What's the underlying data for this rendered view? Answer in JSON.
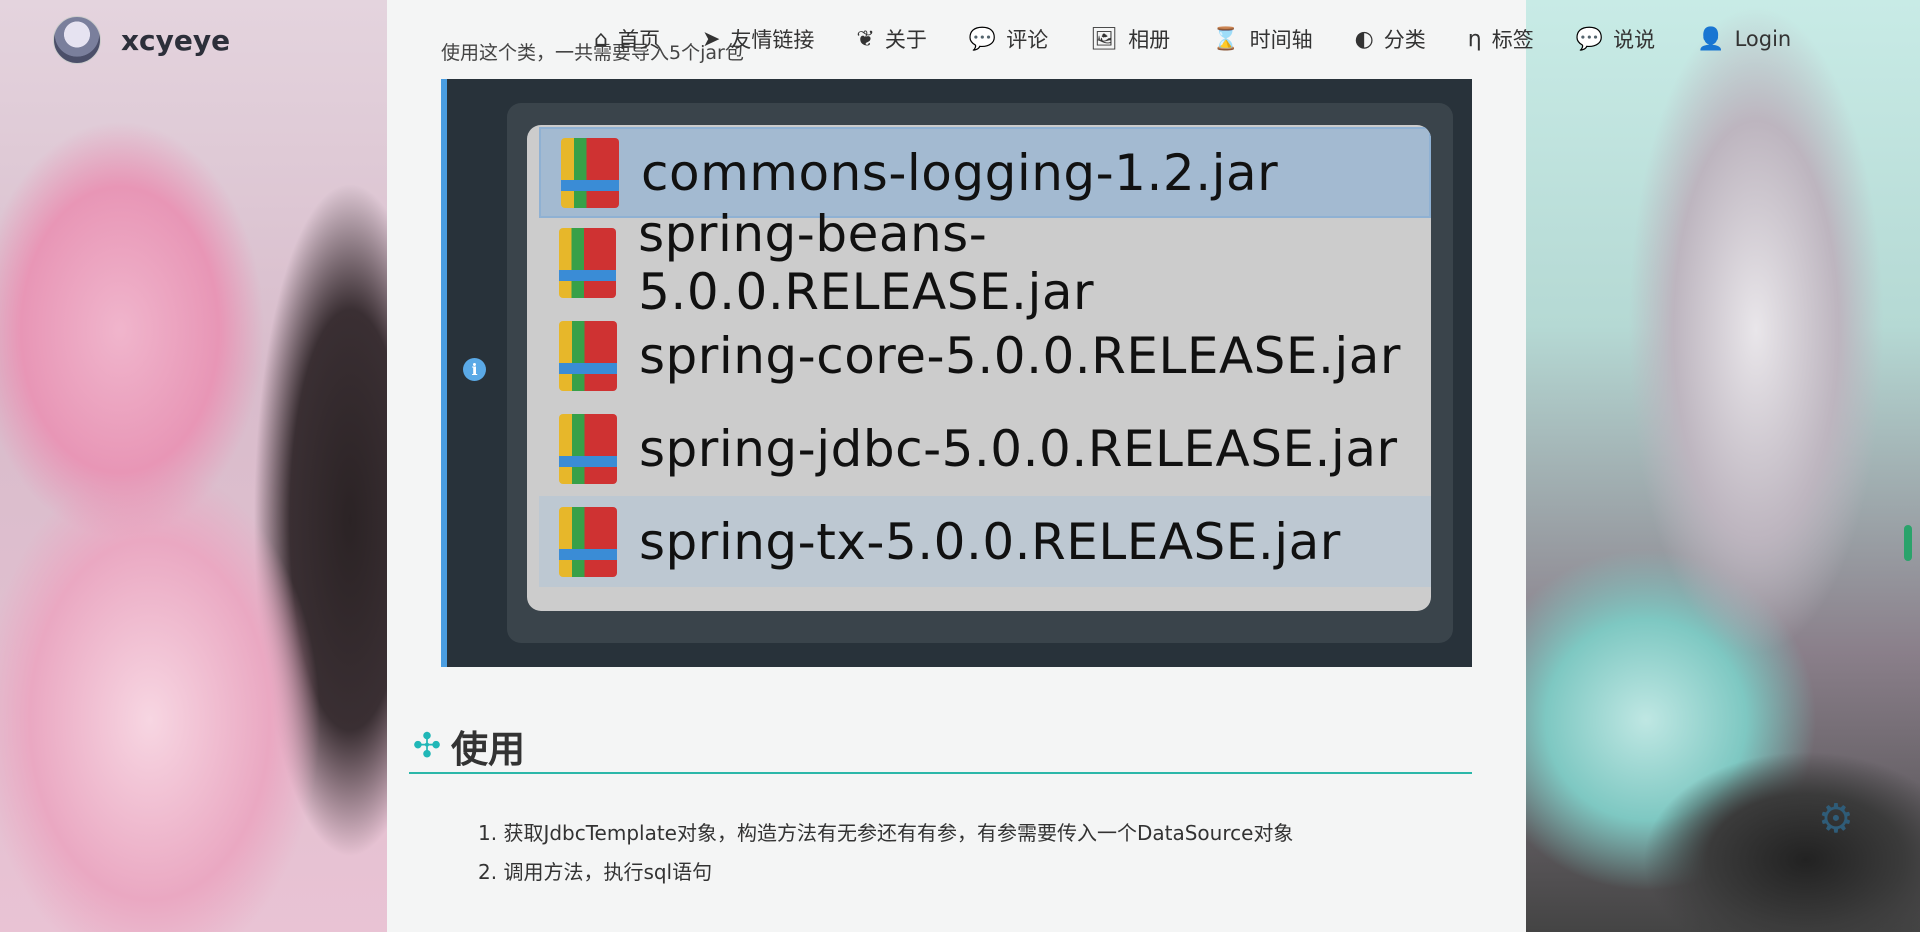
{
  "site": {
    "name": "xcyeye"
  },
  "nav": {
    "items": [
      {
        "id": "home",
        "label": "首页",
        "icon": "⌂"
      },
      {
        "id": "links",
        "label": "友情链接",
        "icon": "➤"
      },
      {
        "id": "about",
        "label": "关于",
        "icon": "❦"
      },
      {
        "id": "comments",
        "label": "评论",
        "icon": "💬"
      },
      {
        "id": "album",
        "label": "相册",
        "icon": "🖼"
      },
      {
        "id": "timeline",
        "label": "时间轴",
        "icon": "⌛"
      },
      {
        "id": "category",
        "label": "分类",
        "icon": "◐"
      },
      {
        "id": "tags",
        "label": "标签",
        "icon": "η"
      },
      {
        "id": "talk",
        "label": "说说",
        "icon": "💬"
      },
      {
        "id": "login",
        "label": "Login",
        "icon": "👤"
      }
    ]
  },
  "article": {
    "intro": "使用这个类，一共需要导入5个jar包",
    "jars": [
      "commons-logging-1.2.jar",
      "spring-beans-5.0.0.RELEASE.jar",
      "spring-core-5.0.0.RELEASE.jar",
      "spring-jdbc-5.0.0.RELEASE.jar",
      "spring-tx-5.0.0.RELEASE.jar"
    ],
    "heading": "使用",
    "steps": [
      "1. 获取JdbcTemplate对象，构造方法有无参还有有参，有参需要传入一个DataSource对象",
      "2. 调用方法，执行sql语句"
    ]
  },
  "colors": {
    "accent": "#2bb7a9",
    "info_border": "#4a9de0",
    "info_bg": "#28323a"
  }
}
